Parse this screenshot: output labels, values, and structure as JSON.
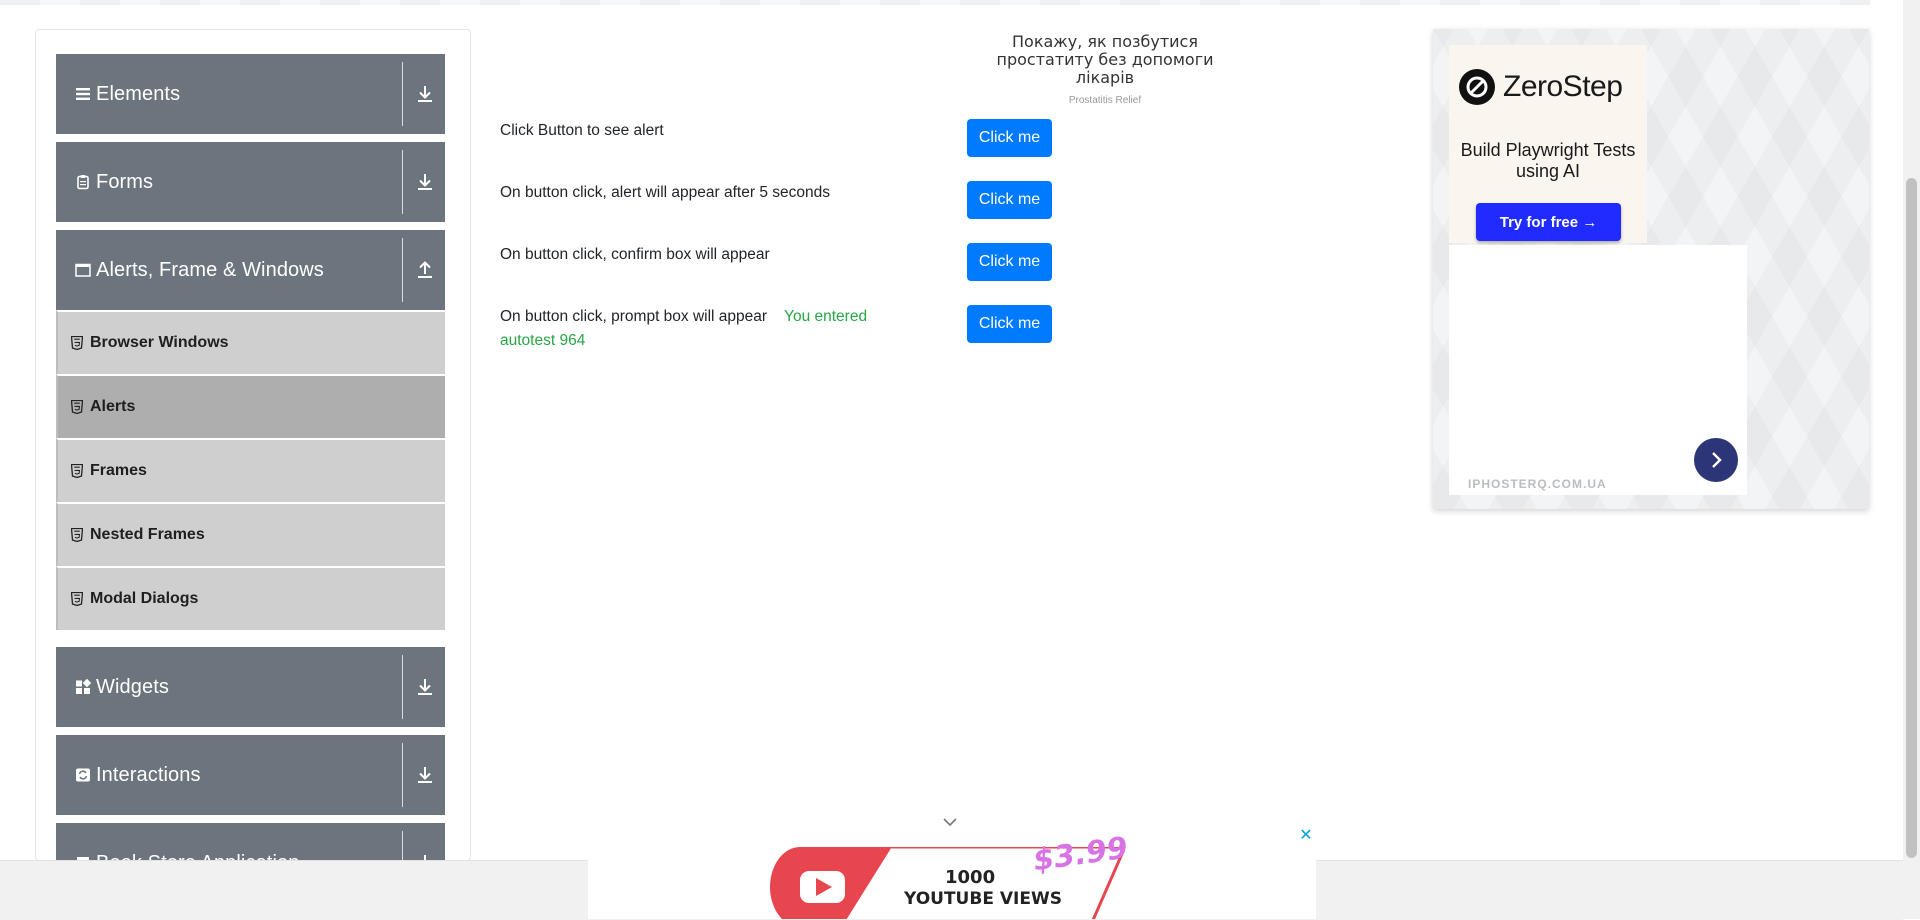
{
  "sidebar": {
    "groups": [
      {
        "label": "Elements",
        "icon": "hamburger-icon",
        "state": "collapsed"
      },
      {
        "label": "Forms",
        "icon": "clipboard-icon",
        "state": "collapsed"
      },
      {
        "label": "Alerts, Frame & Windows",
        "icon": "window-icon",
        "state": "expanded"
      },
      {
        "label": "Widgets",
        "icon": "widgets-icon",
        "state": "collapsed"
      },
      {
        "label": "Interactions",
        "icon": "interactions-icon",
        "state": "collapsed"
      },
      {
        "label": "Book Store Application",
        "icon": "book-icon",
        "state": "collapsed"
      }
    ],
    "items": [
      {
        "label": "Browser Windows",
        "active": false
      },
      {
        "label": "Alerts",
        "active": true
      },
      {
        "label": "Frames",
        "active": false
      },
      {
        "label": "Nested Frames",
        "active": false
      },
      {
        "label": "Modal Dialogs",
        "active": false
      }
    ]
  },
  "top_ad": {
    "text": "Покажу, як позбутися простатиту без допомоги лікарів",
    "source": "Prostatitis Relief"
  },
  "main": {
    "rows": [
      {
        "label": "Click Button to see alert",
        "button": "Click me"
      },
      {
        "label": "On button click, alert will appear after 5 seconds",
        "button": "Click me"
      },
      {
        "label": "On button click, confirm box will appear",
        "button": "Click me"
      },
      {
        "label": "On button click, prompt box will appear",
        "button": "Click me",
        "result": "You entered autotest 964"
      }
    ]
  },
  "right_ad": {
    "brand": "ZeroStep",
    "tagline": "Build Playwright Tests using AI",
    "cta": "Try for free →",
    "domain": "IPHOSTERQ.COM.UA"
  },
  "bottom_ad": {
    "line1": "1000",
    "line2": "YOUTUBE VIEWS",
    "price": "$3.99",
    "close": "✕"
  },
  "colors": {
    "group_header": "#6c757d",
    "menu_item": "#cfcfcf",
    "menu_item_active": "#aeaeae",
    "button_primary": "#007bff",
    "success_text": "#28a745",
    "zerostep_cta": "#1f2bff"
  }
}
